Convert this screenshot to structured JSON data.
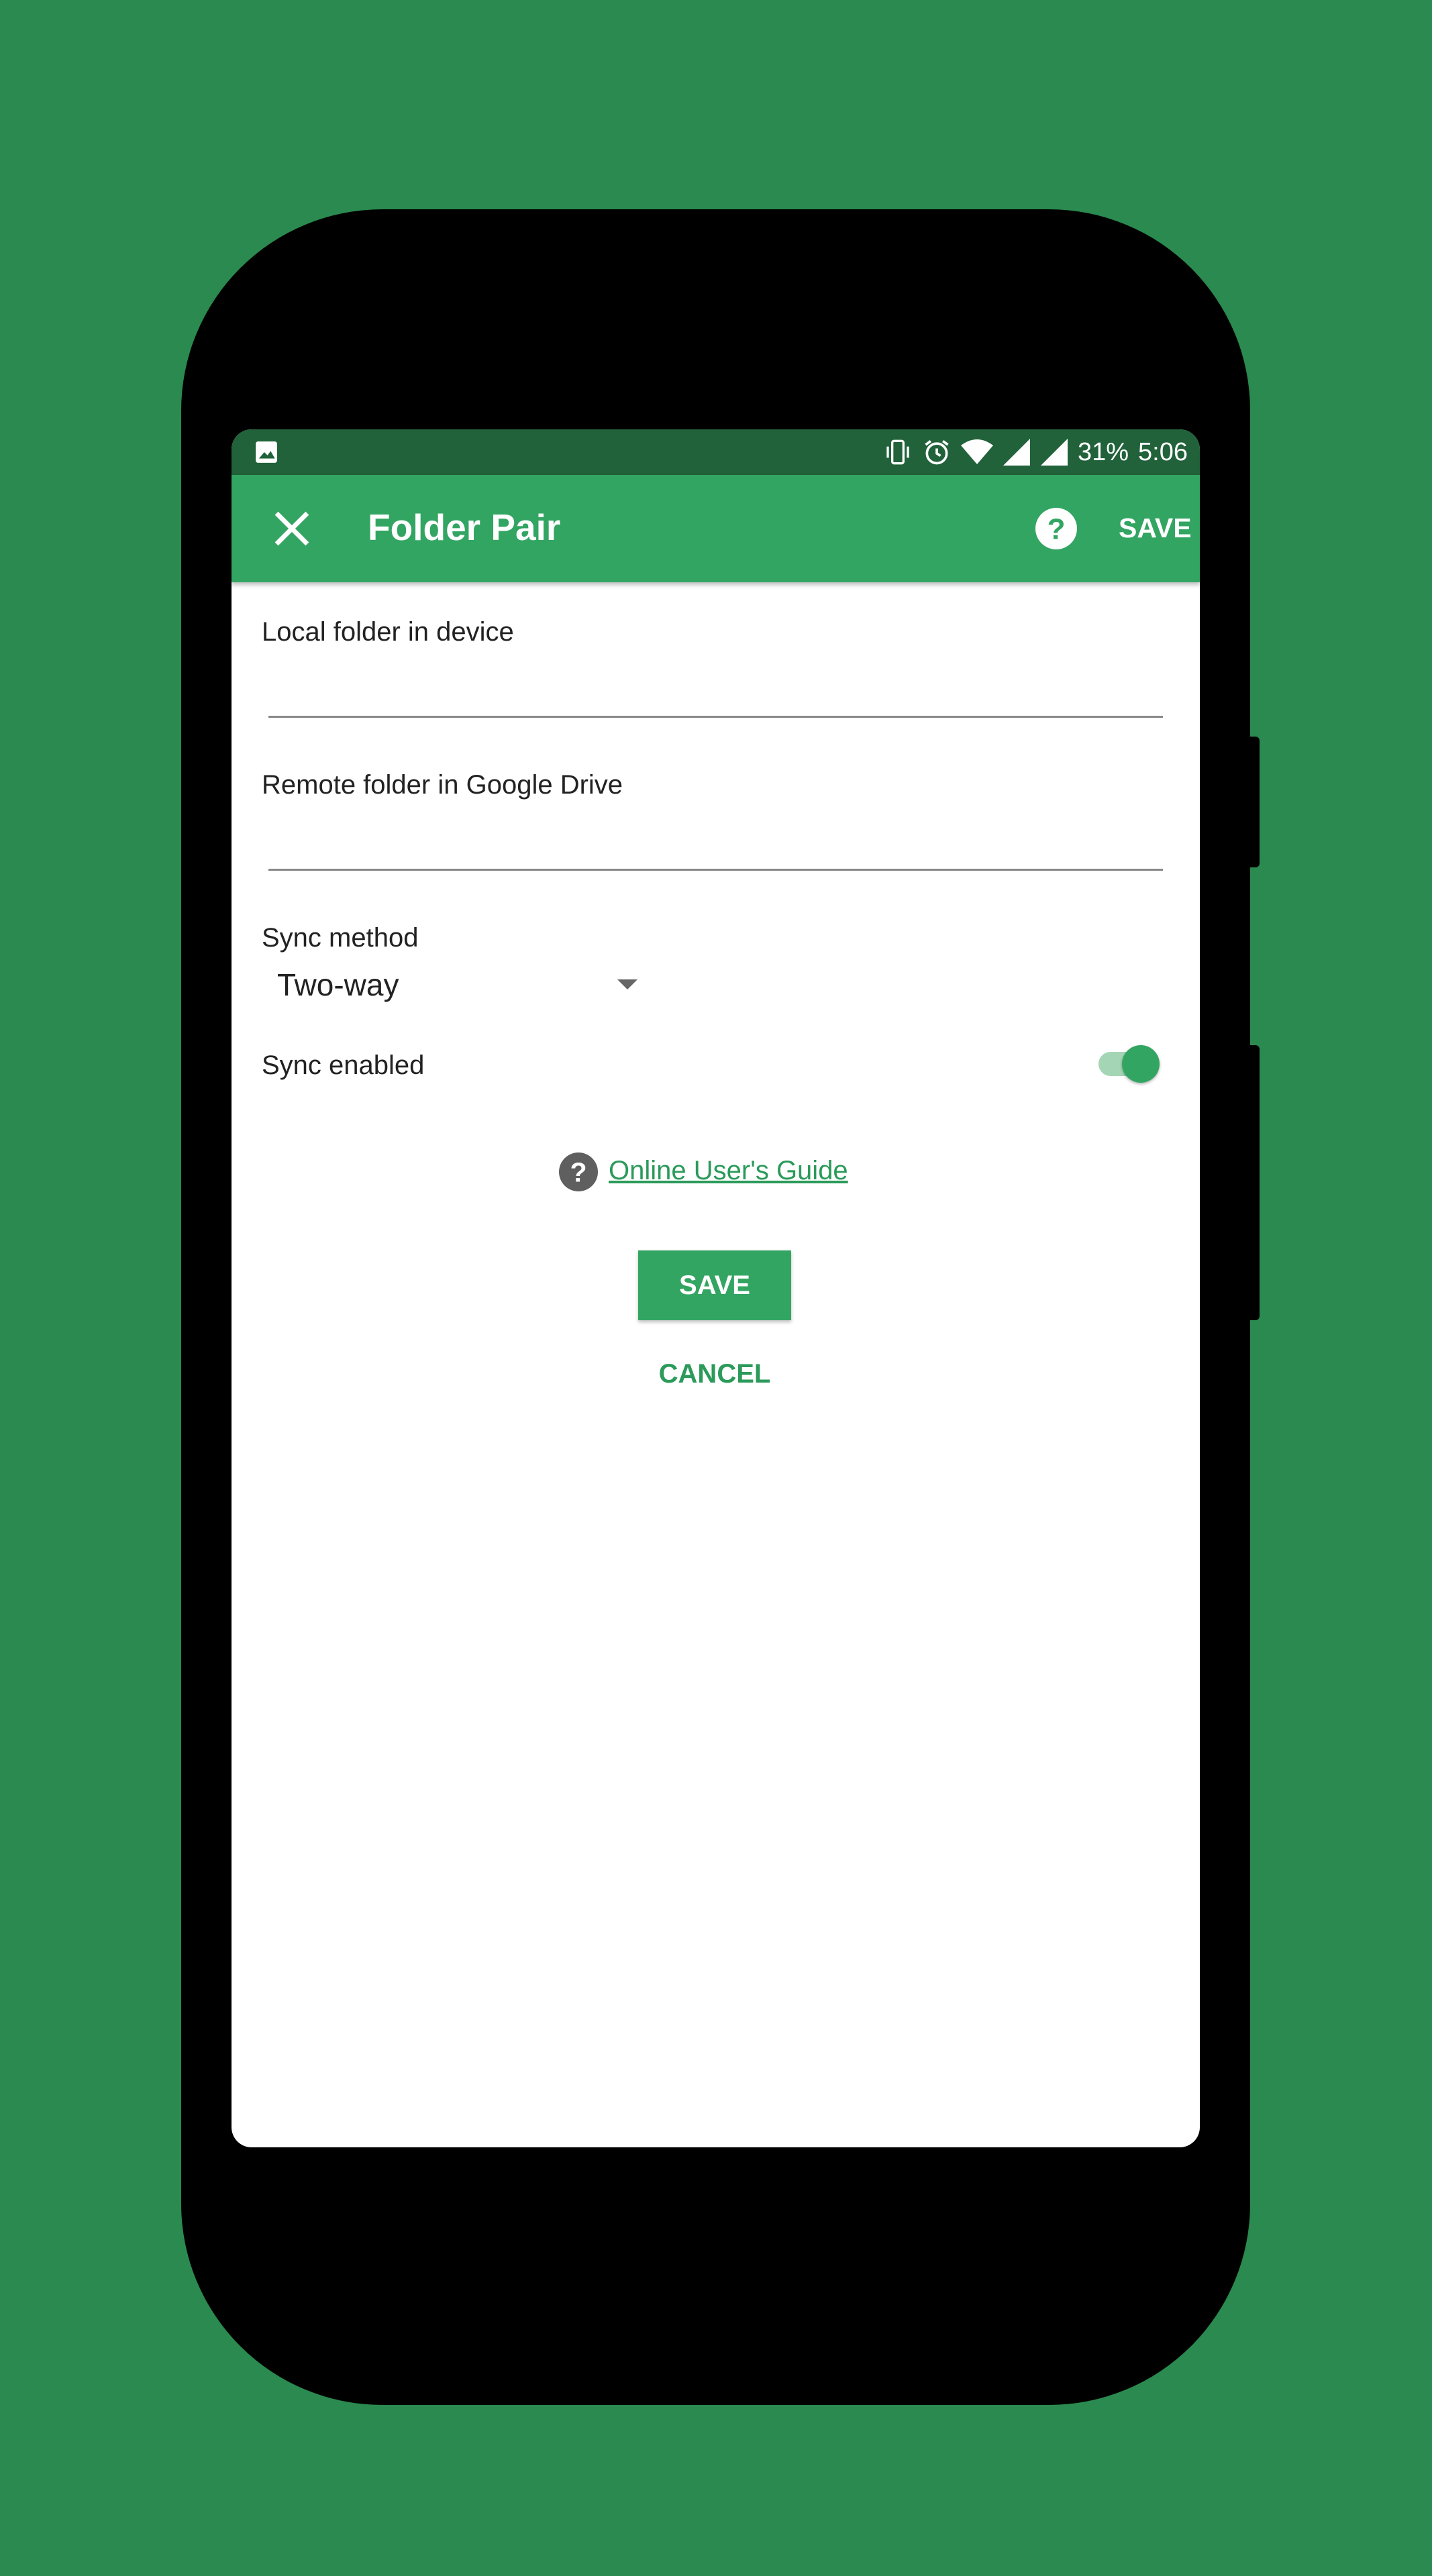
{
  "status_bar": {
    "battery": "31%",
    "time": "5:06"
  },
  "app_bar": {
    "title": "Folder Pair",
    "save_label": "SAVE"
  },
  "form": {
    "local_folder_label": "Local folder in device",
    "local_folder_value": "",
    "remote_folder_label": "Remote folder in Google Drive",
    "remote_folder_value": "",
    "sync_method_label": "Sync method",
    "sync_method_value": "Two-way",
    "sync_enabled_label": "Sync enabled",
    "sync_enabled": true
  },
  "guide_link": "Online User's Guide",
  "buttons": {
    "save": "SAVE",
    "cancel": "CANCEL"
  },
  "colors": {
    "background": "#2a8a4f",
    "status_bar": "#21623a",
    "accent": "#33a562",
    "link": "#2b9a5a"
  },
  "icons": [
    "image-icon",
    "vibrate-icon",
    "alarm-icon",
    "wifi-icon",
    "signal-icon",
    "close-icon",
    "help-icon",
    "dropdown-arrow-icon"
  ]
}
